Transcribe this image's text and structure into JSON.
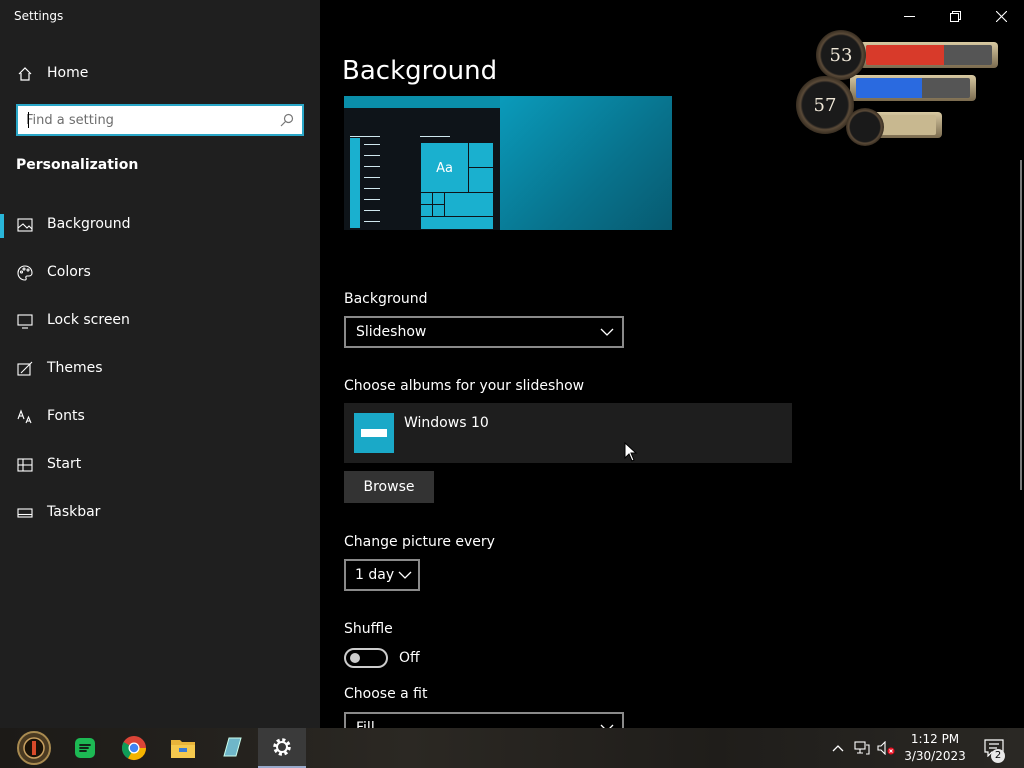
{
  "window": {
    "title": "Settings"
  },
  "sidebar": {
    "home_label": "Home",
    "search_placeholder": "Find a setting",
    "section_title": "Personalization",
    "items": [
      {
        "label": "Background",
        "icon": "image-icon"
      },
      {
        "label": "Colors",
        "icon": "palette-icon"
      },
      {
        "label": "Lock screen",
        "icon": "lock-screen-icon"
      },
      {
        "label": "Themes",
        "icon": "themes-icon"
      },
      {
        "label": "Fonts",
        "icon": "fonts-icon"
      },
      {
        "label": "Start",
        "icon": "start-icon"
      },
      {
        "label": "Taskbar",
        "icon": "taskbar-icon"
      }
    ],
    "active_index": 0
  },
  "main": {
    "title": "Background",
    "preview_tile_text": "Aa",
    "background_label": "Background",
    "background_value": "Slideshow",
    "albums_label": "Choose albums for your slideshow",
    "album_name": "Windows 10",
    "browse_label": "Browse",
    "change_label": "Change picture every",
    "change_value": "1 day",
    "shuffle_label": "Shuffle",
    "shuffle_state": "Off",
    "fit_label": "Choose a fit",
    "fit_value": "Fill"
  },
  "hud": {
    "health_value": "53",
    "mana_value": "57",
    "health_fill": 0.62,
    "mana_fill": 0.58,
    "health_color": "#d83a2a",
    "mana_color": "#2a6ae0"
  },
  "taskbar": {
    "apps": [
      "game-icon",
      "spotify-icon",
      "chrome-icon",
      "file-explorer-icon",
      "notepad-icon",
      "settings-icon"
    ],
    "time": "1:12 PM",
    "date": "3/30/2023",
    "notification_count": "2"
  },
  "colors": {
    "accent": "#29b6d9",
    "sidebar_bg": "#1f1f1f"
  }
}
